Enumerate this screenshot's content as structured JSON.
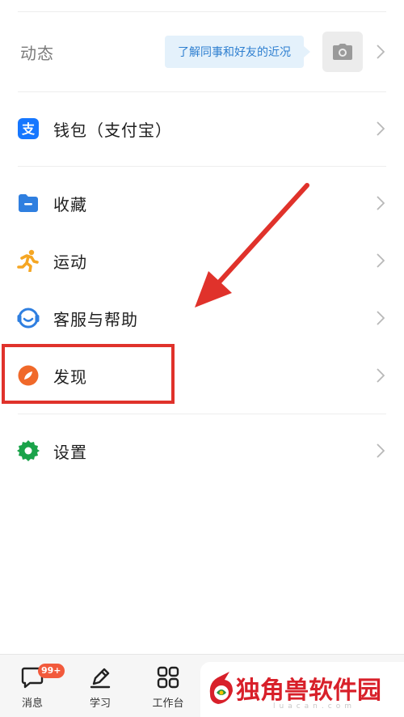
{
  "moments": {
    "label": "动态",
    "hint": "了解同事和好友的近况"
  },
  "menu": [
    {
      "label": "钱包（支付宝）",
      "icon": "alipay-icon"
    },
    {
      "label": "收藏",
      "icon": "folder-icon"
    },
    {
      "label": "运动",
      "icon": "running-icon"
    },
    {
      "label": "客服与帮助",
      "icon": "headset-icon"
    },
    {
      "label": "发现",
      "icon": "compass-icon"
    },
    {
      "label": "设置",
      "icon": "gear-icon"
    }
  ],
  "bottom_nav": {
    "items": [
      {
        "label": "消息",
        "icon": "message-icon",
        "badge": "99+"
      },
      {
        "label": "学习",
        "icon": "pen-icon"
      },
      {
        "label": "工作台",
        "icon": "grid-icon"
      }
    ]
  },
  "watermark": {
    "text": "独角兽软件园",
    "sub": "luacan.com"
  },
  "colors": {
    "highlight": "#e0322b",
    "badge": "#f25a3c",
    "alipay": "#1677ff",
    "folder": "#2f7fe0",
    "running": "#f5a623",
    "headset": "#2f7fe0",
    "compass": "#f0692a",
    "gear": "#1aa34a"
  }
}
